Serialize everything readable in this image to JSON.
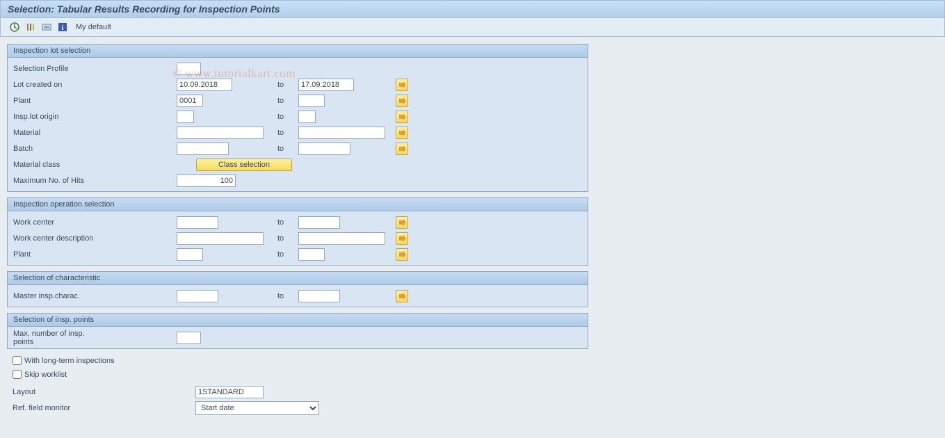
{
  "page_title": "Selection: Tabular Results Recording for Inspection Points",
  "watermark": "© www.tutorialkart.com",
  "toolbar": {
    "my_default": "My default"
  },
  "groups": {
    "lot_selection": {
      "title": "Inspection lot selection",
      "labels": {
        "profile": "Selection Profile",
        "lot_created": "Lot created on",
        "plant": "Plant",
        "origin": "Insp.lot origin",
        "material": "Material",
        "batch": "Batch",
        "material_class": "Material class",
        "max_hits": "Maximum No. of Hits",
        "to": "to"
      },
      "values": {
        "lot_created_from": "10.09.2018",
        "lot_created_to": "17.09.2018",
        "plant_from": "0001",
        "plant_to": "",
        "origin_from": "",
        "origin_to": "",
        "material_from": "",
        "material_to": "",
        "batch_from": "",
        "batch_to": "",
        "max_hits": "100",
        "class_selection_btn": "Class selection",
        "profile": ""
      }
    },
    "op_selection": {
      "title": "Inspection operation selection",
      "labels": {
        "work_center": "Work center",
        "wc_desc": "Work center description",
        "plant": "Plant",
        "to": "to"
      }
    },
    "char_selection": {
      "title": "Selection of characteristic",
      "labels": {
        "master": "Master insp.charac.",
        "to": "to"
      }
    },
    "ip_selection": {
      "title": "Selection of insp. points",
      "labels": {
        "max_ip": "Max. number of insp. points"
      }
    }
  },
  "checkboxes": {
    "long_term": "With long-term inspections",
    "skip_worklist": "Skip worklist"
  },
  "bottom": {
    "layout_label": "Layout",
    "layout_value": "1STANDARD",
    "ref_label": "Ref. field monitor",
    "ref_value": "Start date"
  }
}
